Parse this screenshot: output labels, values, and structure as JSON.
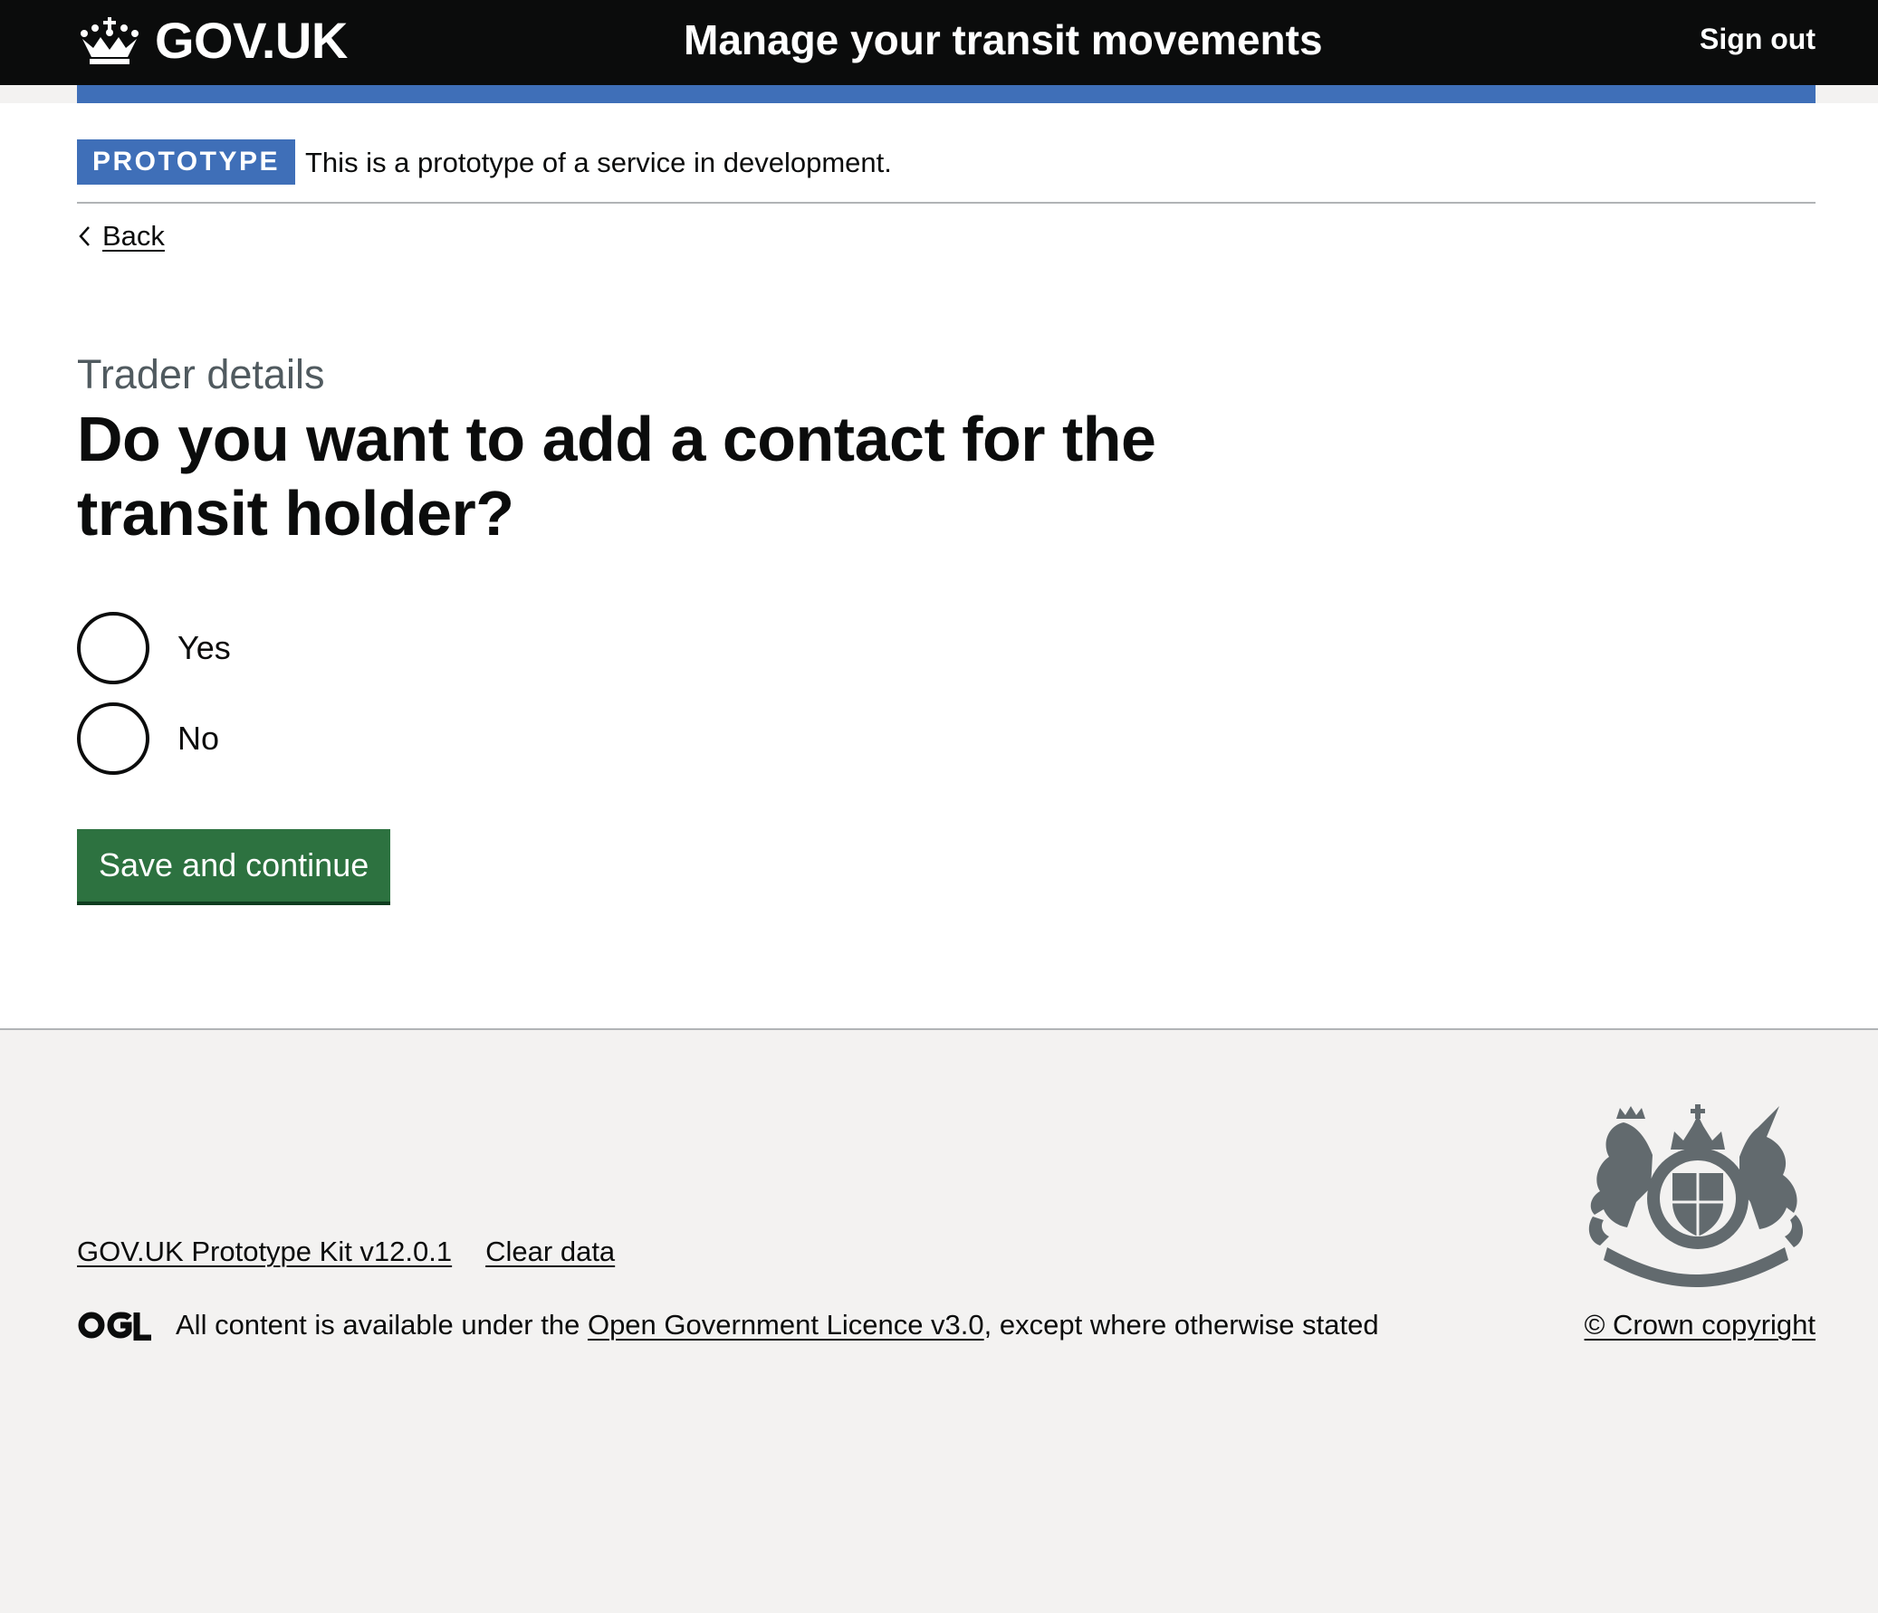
{
  "header": {
    "logo_text": "GOV.UK",
    "service_name": "Manage your transit movements",
    "sign_out_label": "Sign out"
  },
  "phase_banner": {
    "tag": "PROTOTYPE",
    "text": "This is a prototype of a service in development."
  },
  "back_link": {
    "label": "Back"
  },
  "question": {
    "caption": "Trader details",
    "heading": "Do you want to add a contact for the transit holder?",
    "options": [
      {
        "label": "Yes"
      },
      {
        "label": "No"
      }
    ]
  },
  "form": {
    "submit_label": "Save and continue"
  },
  "footer": {
    "links": [
      {
        "label": "GOV.UK Prototype Kit v12.0.1"
      },
      {
        "label": "Clear data"
      }
    ],
    "licence_prefix": "All content is available under the ",
    "licence_link": "Open Government Licence v3.0",
    "licence_suffix": ", except where otherwise stated",
    "copyright": "© Crown copyright"
  },
  "colors": {
    "header_bg": "#0b0c0c",
    "brand_blue": "#3f6fb8",
    "button_green": "#2d7240",
    "caption_grey": "#505a5f",
    "footer_bg": "#f3f2f1",
    "border_grey": "#b1b4b6"
  },
  "icons": {
    "logo": "crown-icon",
    "back": "chevron-left-icon",
    "licence": "ogl-icon",
    "footer_emblem": "royal-coat-of-arms-icon"
  }
}
